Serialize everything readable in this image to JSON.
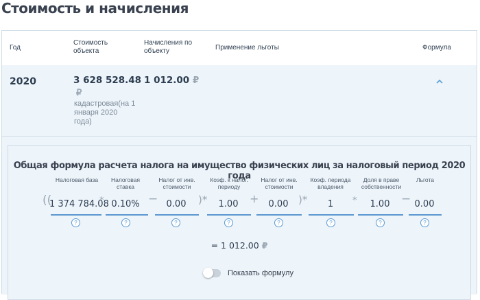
{
  "page": {
    "title": "Стоимость и начисления"
  },
  "table": {
    "headers": {
      "year": "Год",
      "cost": "Стоимость объекта",
      "accrual": "Начисления по объекту",
      "benefit": "Применение льготы",
      "formula": "Формула"
    },
    "row": {
      "year": "2020",
      "cost": "3 628 528.48",
      "currency": "₽",
      "cost_note": "кадастровая(на 1 января 2020 года)",
      "accrual": "1 012.00",
      "accrual_currency": "₽"
    }
  },
  "formula": {
    "title": "Общая формула расчета налога на имущество физических лиц за налоговый период 2020 года",
    "items": [
      {
        "label": "Налоговая база",
        "value": "1 374 784.08"
      },
      {
        "label": "Налоговая ставка",
        "value": "0.10%"
      },
      {
        "label": "Налог от инв. стоимости",
        "value": "0.00"
      },
      {
        "label": "Коэф. к налог. периоду",
        "value": "1.00"
      },
      {
        "label": "Налог от инв. стоимости",
        "value": "0.00"
      },
      {
        "label": "Коэф. периода владения",
        "value": "1"
      },
      {
        "label": "Доля в праве собственности",
        "value": "1.00"
      },
      {
        "label": "Льгота",
        "value": "0.00"
      }
    ],
    "help_glyph": "?",
    "operators": {
      "open": "((",
      "mul": "*",
      "minus": "−",
      "close_mul": ")*",
      "plus": "+"
    },
    "result": "= 1 012.00",
    "result_currency": "₽"
  },
  "toggle": {
    "label": "Показать формулу",
    "on": false
  },
  "icons": {
    "expand": "chevron-up-icon",
    "help": "question-circle-icon"
  },
  "colors": {
    "accent": "#5b97cf",
    "panel_bg": "#edf4fa"
  }
}
